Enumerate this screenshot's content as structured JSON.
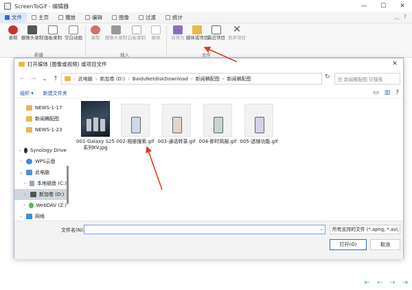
{
  "app": {
    "title": "ScreenToGif - 编辑器",
    "window_controls": {
      "minimize": "—",
      "maximize": "☐",
      "close": "✕"
    }
  },
  "menu": {
    "tabs": [
      {
        "label": "文件",
        "icon": "file-icon"
      },
      {
        "label": "主页",
        "icon": "home-icon"
      },
      {
        "label": "播放",
        "icon": "play-icon"
      },
      {
        "label": "编辑",
        "icon": "edit-icon"
      },
      {
        "label": "图像",
        "icon": "image-icon"
      },
      {
        "label": "过渡",
        "icon": "transition-icon"
      },
      {
        "label": "统计",
        "icon": "stats-icon"
      }
    ],
    "right": {
      "collapse": "︿",
      "help": "?"
    }
  },
  "ribbon": {
    "buttons": [
      {
        "label": "录制",
        "icon": "record-icon",
        "color": "#c0392b"
      },
      {
        "label": "摄像头录制",
        "icon": "webcam-icon",
        "color": "#555555"
      },
      {
        "label": "画板录制",
        "icon": "board-icon",
        "color": "#777777"
      },
      {
        "label": "空白动画",
        "icon": "blank-icon",
        "color": "#888888"
      },
      {
        "label": "录制",
        "icon": "record-icon",
        "color": "#c0392b"
      },
      {
        "label": "摄像头录制",
        "icon": "webcam-icon",
        "color": "#888888"
      },
      {
        "label": "白板录制",
        "icon": "board-icon",
        "color": "#aaaaaa"
      },
      {
        "label": "媒体",
        "icon": "media-icon",
        "color": "#bbbbbb"
      },
      {
        "label": "另存为",
        "icon": "save-icon",
        "color": "#6a3fb5"
      },
      {
        "label": "媒体或项目",
        "icon": "folder-icon",
        "color": "#e8b84a"
      },
      {
        "label": "最近项目",
        "icon": "recent-icon",
        "color": "#666666"
      },
      {
        "label": "放弃项目",
        "icon": "discard-icon",
        "color": "#555555"
      }
    ],
    "groups": {
      "new": "新建",
      "insert": "插入",
      "file": "文件"
    }
  },
  "dialog": {
    "title": "打开媒体 (图像或视频) 或项目文件",
    "close": "✕",
    "nav": {
      "back": "←",
      "forward": "→",
      "down": "⌄",
      "up": "↑"
    },
    "breadcrumb": [
      "此电脑",
      "新加卷 (D:)",
      "BaiduNetdiskDownload",
      "新闻稿配图",
      "新闻稿配图"
    ],
    "refresh": "↻",
    "search_placeholder": "在 新闻稿配图 中搜索",
    "organize": "组织 ▾",
    "new_folder": "新建文件夹",
    "sidebar": [
      {
        "label": "NEWS-1-17",
        "chevron": "",
        "icon": "folder-icon"
      },
      {
        "label": "新闻稿配图",
        "chevron": "",
        "icon": "folder-icon"
      },
      {
        "label": "NEWS-1-23",
        "chevron": "",
        "icon": "folder-icon"
      },
      {
        "label": "Synology Drive",
        "chevron": "›",
        "icon": "drive-icon"
      },
      {
        "label": "WPS云盘",
        "chevron": "›",
        "icon": "cloud-icon"
      },
      {
        "label": "此电脑",
        "chevron": "⌄",
        "icon": "computer-icon"
      },
      {
        "label": "本地磁盘 (C:)",
        "chevron": "›",
        "icon": "disk-icon"
      },
      {
        "label": "新加卷 (D:)",
        "chevron": "›",
        "icon": "disk-icon"
      },
      {
        "label": "WebDAV (Z:)",
        "chevron": "›",
        "icon": "network-drive-icon"
      },
      {
        "label": "网络",
        "chevron": "›",
        "icon": "network-icon"
      }
    ],
    "files": [
      {
        "name": "001-Galaxy S25系列KV.jpg",
        "line1": "001-Galaxy S25",
        "line2": "系列KV.jpg"
      },
      {
        "name": "002-相册搜索.gif",
        "line1": "002-相册搜索.gif",
        "line2": ""
      },
      {
        "name": "003-通话转录.gif",
        "line1": "003-通话转录.gif",
        "line2": ""
      },
      {
        "name": "004-即时简报.gif",
        "line1": "004-即时简报.gif",
        "line2": ""
      },
      {
        "name": "005-透镜功能.gif",
        "line1": "005-透镜功能.gif",
        "line2": ""
      }
    ],
    "filename_label": "文件名(N):",
    "filename_value": "",
    "filetype": "所有支持的文件 (*.apng, *.avi,",
    "open_button": "打开(O)",
    "cancel_button": "取消"
  },
  "footer_nav": [
    "⇤",
    "←",
    "→",
    "⇥"
  ],
  "colors": {
    "accent": "#2f6ec7",
    "annotation": "#e03a2b",
    "folder": "#e8b84a"
  }
}
